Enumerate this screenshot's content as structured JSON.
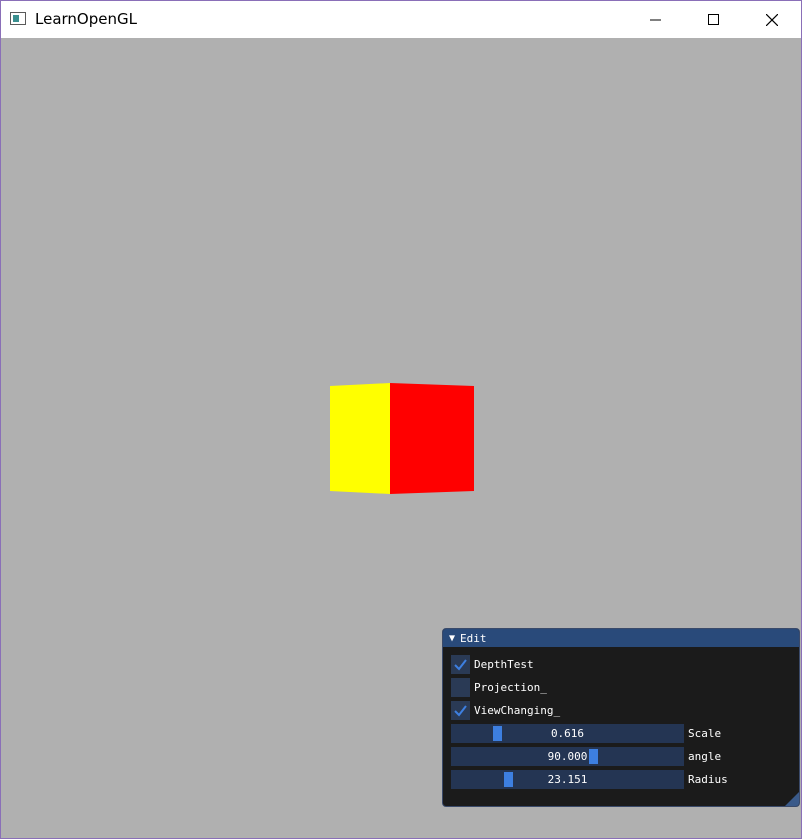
{
  "window": {
    "title": "LearnOpenGL",
    "app_icon": "opengl-window-icon",
    "controls": {
      "minimize_icon": "minimize-icon",
      "maximize_icon": "maximize-icon",
      "close_icon": "close-icon"
    }
  },
  "scene": {
    "background_color": "#b0b0b0",
    "cube": {
      "left_face_color": "#ffff00",
      "right_face_color": "#ff0000"
    }
  },
  "edit_panel": {
    "title": "Edit",
    "collapse_icon": "triangle-down-icon",
    "checkboxes": [
      {
        "label": "DepthTest",
        "checked": true
      },
      {
        "label": "Projection_",
        "checked": false
      },
      {
        "label": "ViewChanging_",
        "checked": true
      }
    ],
    "sliders": [
      {
        "label": "Scale",
        "value": "0.616",
        "fraction": 0.18
      },
      {
        "label": "angle",
        "value": "90.000",
        "fraction": 0.62
      },
      {
        "label": "Radius",
        "value": "23.151",
        "fraction": 0.23
      }
    ],
    "accent_color": "#3d7fe0"
  }
}
